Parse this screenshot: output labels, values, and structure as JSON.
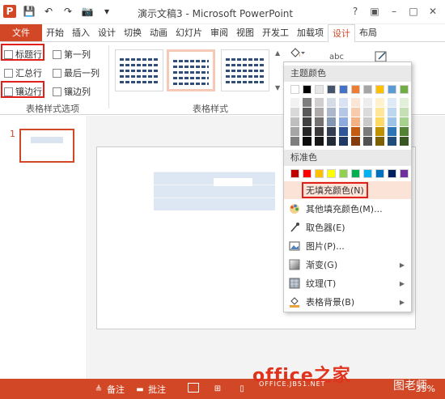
{
  "window": {
    "title": "演示文稿3 - Microsoft PowerPoint",
    "controls": [
      "?",
      "▣",
      "–",
      "□",
      "✕"
    ]
  },
  "qat": [
    "P",
    "💾",
    "↶",
    "↷",
    "📷",
    "▾"
  ],
  "tabs": [
    "文件",
    "开始",
    "插入",
    "设计",
    "切换",
    "动画",
    "幻灯片",
    "审阅",
    "视图",
    "开发工",
    "加载项",
    "设计",
    "布局"
  ],
  "active_tab_index": 11,
  "ribbon": {
    "options": [
      {
        "label": "标题行",
        "checked": false
      },
      {
        "label": "汇总行",
        "checked": false
      },
      {
        "label": "镶边行",
        "checked": false
      },
      {
        "label": "第一列",
        "checked": false
      },
      {
        "label": "最后一列",
        "checked": false
      },
      {
        "label": "镶边列",
        "checked": false
      }
    ],
    "group1_label": "表格样式选项",
    "group2_label": "表格样式"
  },
  "slide_panel": {
    "number": "1"
  },
  "dropdown": {
    "theme_colors_label": "主题颜色",
    "standard_colors_label": "标准色",
    "theme_top_row": [
      "#ffffff",
      "#000000",
      "#e7e6e6",
      "#44546a",
      "#4472c4",
      "#ed7d31",
      "#a5a5a5",
      "#ffc000",
      "#5b9bd5",
      "#70ad47"
    ],
    "theme_columns": [
      [
        "#f2f2f2",
        "#d9d9d9",
        "#bfbfbf",
        "#a6a6a6",
        "#7f7f7f"
      ],
      [
        "#7f7f7f",
        "#595959",
        "#404040",
        "#262626",
        "#0d0d0d"
      ],
      [
        "#d0cece",
        "#aeaaaa",
        "#757171",
        "#3a3838",
        "#171616"
      ],
      [
        "#d6dce5",
        "#adb9ca",
        "#8497b0",
        "#333f50",
        "#222a35"
      ],
      [
        "#dae3f3",
        "#b4c7e7",
        "#8faadc",
        "#2f5597",
        "#1f3864"
      ],
      [
        "#fbe5d6",
        "#f8cbad",
        "#f4b183",
        "#c55a11",
        "#843c0c"
      ],
      [
        "#ededed",
        "#dbdbdb",
        "#c9c9c9",
        "#7b7b7b",
        "#525252"
      ],
      [
        "#fff2cc",
        "#ffe699",
        "#ffd966",
        "#bf9000",
        "#7f6000"
      ],
      [
        "#deebf7",
        "#bdd7ee",
        "#9dc3e6",
        "#2e75b6",
        "#1f4e79"
      ],
      [
        "#e2f0d9",
        "#c5e0b4",
        "#a9d18e",
        "#548235",
        "#385723"
      ]
    ],
    "standard_colors": [
      "#c00000",
      "#ff0000",
      "#ffc000",
      "#ffff00",
      "#92d050",
      "#00b050",
      "#00b0f0",
      "#0070c0",
      "#002060",
      "#7030a0"
    ],
    "items": [
      {
        "label": "无填充颜色(N)",
        "icon": "",
        "highlight": true,
        "submenu": false
      },
      {
        "label": "其他填充颜色(M)...",
        "icon": "palette-icon",
        "highlight": false,
        "submenu": false
      },
      {
        "label": "取色器(E)",
        "icon": "eyedropper-icon",
        "highlight": false,
        "submenu": false
      },
      {
        "label": "图片(P)...",
        "icon": "picture-icon",
        "highlight": false,
        "submenu": false
      },
      {
        "label": "渐变(G)",
        "icon": "gradient-icon",
        "highlight": false,
        "submenu": true
      },
      {
        "label": "纹理(T)",
        "icon": "texture-icon",
        "highlight": false,
        "submenu": true
      },
      {
        "label": "表格背景(B)",
        "icon": "table-background-icon",
        "highlight": false,
        "submenu": true
      }
    ]
  },
  "status": {
    "notes": "备注",
    "comments": "批注",
    "zoom": "35%"
  },
  "watermark": {
    "brand": "office之家",
    "url": "OFFICE.JB51.NET",
    "corner": "图老师"
  }
}
